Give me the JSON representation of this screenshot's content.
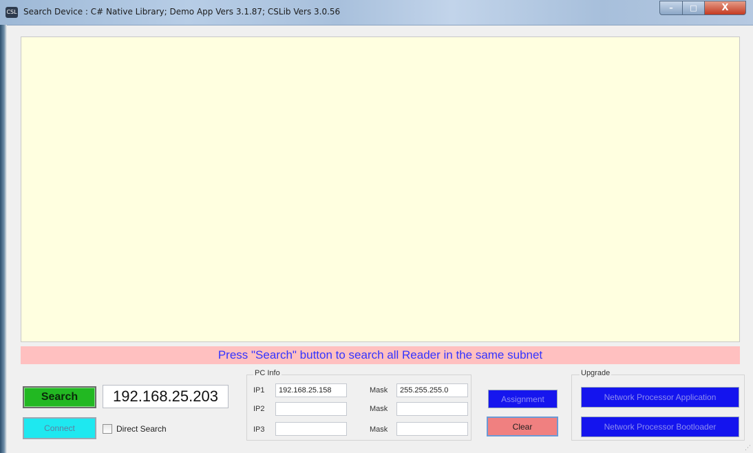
{
  "window": {
    "title": "Search Device : C# Native Library; Demo App Vers 3.1.87; CSLib Vers 3.0.56",
    "icon_label": "CSL",
    "controls": {
      "minimize": "–",
      "maximize": "□",
      "close": "X"
    }
  },
  "status_message": "Press \"Search\" button to search all Reader in the same subnet",
  "search": {
    "button_label": "Search",
    "ip_value": "192.168.25.203",
    "connect_label": "Connect",
    "direct_search_label": "Direct Search",
    "direct_search_checked": false
  },
  "pc_info": {
    "title": "PC Info",
    "rows": [
      {
        "ip_label": "IP1",
        "ip_value": "192.168.25.158",
        "mask_label": "Mask",
        "mask_value": "255.255.255.0"
      },
      {
        "ip_label": "IP2",
        "ip_value": "",
        "mask_label": "Mask",
        "mask_value": ""
      },
      {
        "ip_label": "IP3",
        "ip_value": "",
        "mask_label": "Mask",
        "mask_value": ""
      }
    ]
  },
  "actions": {
    "assignment_label": "Assignment",
    "clear_label": "Clear"
  },
  "upgrade": {
    "title": "Upgrade",
    "application_label": "Network Processor Application",
    "bootloader_label": "Network Processor Bootloader"
  },
  "colors": {
    "results_bg": "#ffffe0",
    "status_bg": "#ffc0c0",
    "status_text": "#3333ff",
    "search_button": "#22b822",
    "connect_button": "#1ee8f0",
    "blue_button": "#1414ee",
    "clear_button": "#f08080"
  },
  "icons": {
    "resize_grip": "resize-grip-icon",
    "app": "app-logo-icon"
  }
}
